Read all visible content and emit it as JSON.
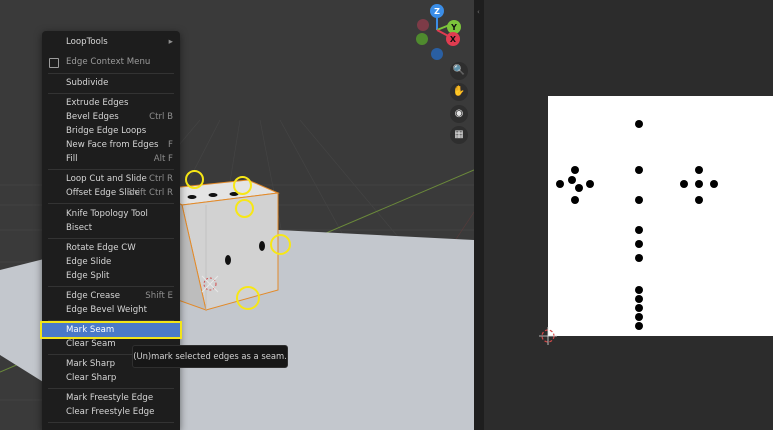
{
  "context_menu": {
    "header": "Edge Context Menu",
    "items": [
      {
        "label": "LoopTools",
        "shortcut": "▸"
      },
      {
        "label": "Subdivide",
        "shortcut": ""
      },
      {
        "label": "Extrude Edges",
        "shortcut": ""
      },
      {
        "label": "Bevel Edges",
        "shortcut": "Ctrl B"
      },
      {
        "label": "Bridge Edge Loops",
        "shortcut": ""
      },
      {
        "label": "New Face from Edges",
        "shortcut": "F"
      },
      {
        "label": "Fill",
        "shortcut": "Alt F"
      },
      {
        "label": "Loop Cut and Slide",
        "shortcut": "Ctrl R"
      },
      {
        "label": "Offset Edge Slide",
        "shortcut": "Shift Ctrl R"
      },
      {
        "label": "Knife Topology Tool",
        "shortcut": ""
      },
      {
        "label": "Bisect",
        "shortcut": ""
      },
      {
        "label": "Rotate Edge CW",
        "shortcut": ""
      },
      {
        "label": "Edge Slide",
        "shortcut": ""
      },
      {
        "label": "Edge Split",
        "shortcut": ""
      },
      {
        "label": "Edge Crease",
        "shortcut": "Shift E"
      },
      {
        "label": "Edge Bevel Weight",
        "shortcut": ""
      },
      {
        "label": "Mark Seam",
        "shortcut": ""
      },
      {
        "label": "Clear Seam",
        "shortcut": ""
      },
      {
        "label": "Mark Sharp",
        "shortcut": ""
      },
      {
        "label": "Clear Sharp",
        "shortcut": ""
      },
      {
        "label": "Mark Freestyle Edge",
        "shortcut": ""
      },
      {
        "label": "Clear Freestyle Edge",
        "shortcut": ""
      }
    ]
  },
  "tooltip": "(Un)mark selected edges as a seam.",
  "gizmo": {
    "z": "Z",
    "y": "Y",
    "x": "X"
  },
  "colors": {
    "menu_bg": "#1d1d1d",
    "highlight": "#4a79c9",
    "annotation": "#f7e716",
    "axis_x": "#e03c50",
    "axis_y": "#7cc53b",
    "axis_z": "#3b8ee8"
  },
  "nav_icons": [
    "zoom-icon",
    "hand-pan-icon",
    "camera-icon",
    "grid-icon"
  ]
}
